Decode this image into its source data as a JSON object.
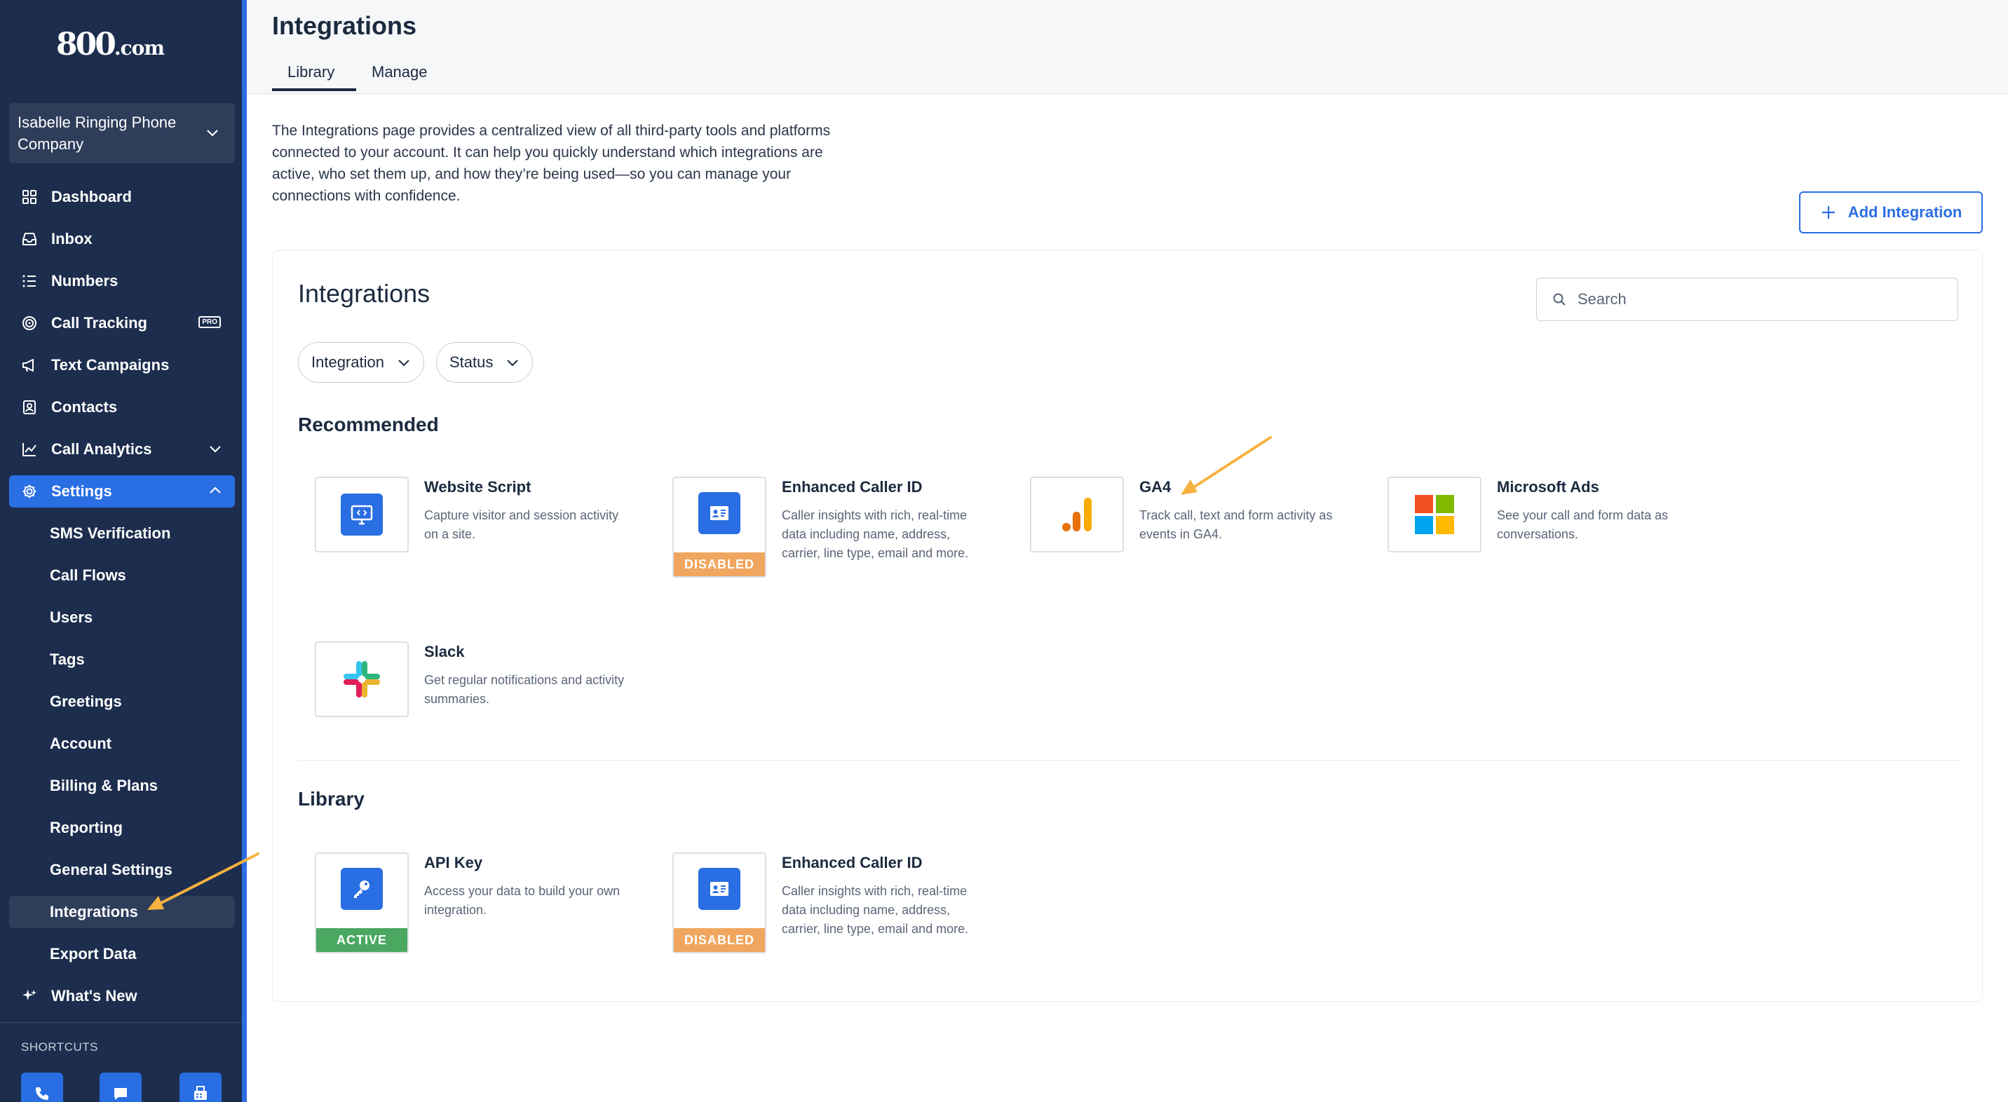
{
  "brand": {
    "logo_main": "800",
    "logo_suffix": ".com",
    "accent": "#2a6ee3",
    "sidebar_bg": "#1c2d4d",
    "arrow_color": "#f6b23f"
  },
  "account": {
    "name": "Isabelle Ringing Phone Company"
  },
  "nav": {
    "dashboard": "Dashboard",
    "inbox": "Inbox",
    "numbers": "Numbers",
    "call_tracking": "Call Tracking",
    "call_tracking_badge": "PRO",
    "text_campaigns": "Text Campaigns",
    "contacts": "Contacts",
    "call_analytics": "Call Analytics",
    "settings": "Settings",
    "settings_children": {
      "sms_verification": "SMS Verification",
      "call_flows": "Call Flows",
      "users": "Users",
      "tags": "Tags",
      "greetings": "Greetings",
      "account": "Account",
      "billing": "Billing & Plans",
      "reporting": "Reporting",
      "general": "General Settings",
      "integrations": "Integrations",
      "export": "Export Data"
    },
    "whats_new": "What's New",
    "shortcuts_label": "SHORTCUTS"
  },
  "header": {
    "title": "Integrations",
    "tabs": {
      "library": "Library",
      "manage": "Manage"
    }
  },
  "intro": "The Integrations page provides a centralized view of all third-party tools and platforms connected to your account. It can help you quickly understand which integrations are active, who set them up, and how they’re being used—so you can manage your connections with confidence.",
  "add_button": "Add Integration",
  "panel": {
    "title": "Integrations",
    "search_placeholder": "Search",
    "filters": {
      "integration": "Integration",
      "status": "Status"
    },
    "recommended_title": "Recommended",
    "library_title": "Library",
    "recommended": [
      {
        "name": "Website Script",
        "desc": "Capture visitor and session activity on a site.",
        "icon": "monitor-code-icon"
      },
      {
        "name": "Enhanced Caller ID",
        "desc": "Caller insights with rich, real-time data including name, address, carrier, line type, email and more.",
        "icon": "id-card-icon",
        "badge": "DISABLED"
      },
      {
        "name": "GA4",
        "desc": "Track call, text and form activity as events in GA4.",
        "icon": "ga4-icon"
      },
      {
        "name": "Microsoft Ads",
        "desc": "See your call and form data as conversations.",
        "icon": "microsoft-icon"
      },
      {
        "name": "Slack",
        "desc": "Get regular notifications and activity summaries.",
        "icon": "slack-icon"
      }
    ],
    "library": [
      {
        "name": "API Key",
        "desc": "Access your data to build your own integration.",
        "icon": "key-icon",
        "badge": "ACTIVE"
      },
      {
        "name": "Enhanced Caller ID",
        "desc": "Caller insights with rich, real-time data including name, address, carrier, line type, email and more.",
        "icon": "id-card-icon",
        "badge": "DISABLED"
      }
    ]
  }
}
